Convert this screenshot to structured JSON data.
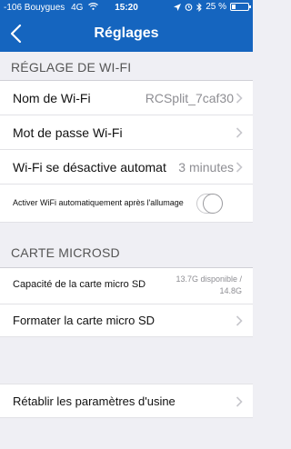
{
  "status_bar": {
    "carrier": "-106 Bouygues",
    "network": "4G",
    "time": "15:20",
    "battery": "25 %",
    "battery_level": 0.25
  },
  "nav": {
    "title": "Réglages"
  },
  "sections": {
    "wifi": {
      "header": "RÉGLAGE DE WI-FI",
      "wifi_name": {
        "label": "Nom de Wi-Fi",
        "value": "RCSplit_7caf30"
      },
      "wifi_password": {
        "label": "Mot de passe Wi-Fi"
      },
      "wifi_timeout": {
        "label": "Wi-Fi se désactive automat",
        "value": "3 minutes"
      },
      "auto_wifi": {
        "label": "Activer WiFi automatiquement après l'allumage",
        "enabled": false
      }
    },
    "sd": {
      "header": "CARTE MICROSD",
      "capacity": {
        "label": "Capacité de la carte micro SD",
        "value_line1": "13.7G disponible /",
        "value_line2": "14.8G"
      },
      "format": {
        "label": "Formater la carte micro SD"
      }
    },
    "reset": {
      "label": "Rétablir les paramètres d'usine"
    }
  }
}
